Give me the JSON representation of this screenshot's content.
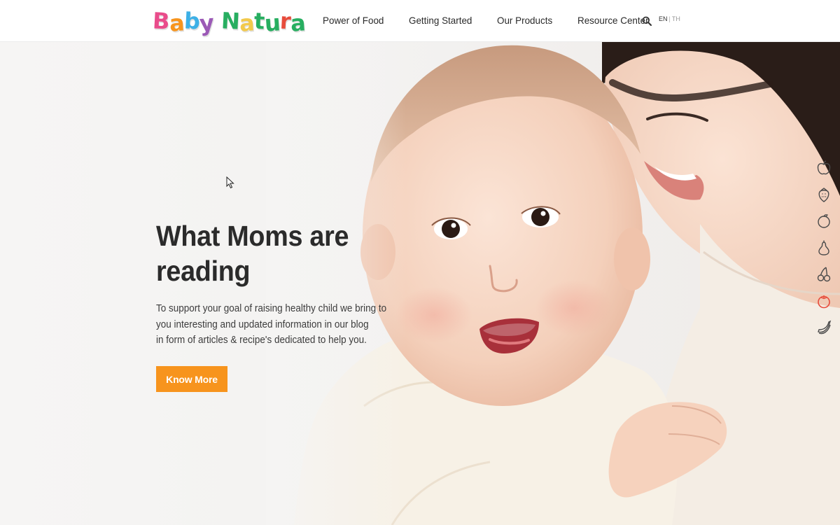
{
  "header": {
    "logo": {
      "word1": "Baby",
      "word2": "Natura",
      "word1_colors": [
        "#e94c8b",
        "#f7941d",
        "#3db0e6",
        "#9b59b6"
      ],
      "word2_colors": [
        "#27ae60",
        "#f2c94c",
        "#27ae60",
        "#27ae60",
        "#e74c3c",
        "#27ae60"
      ]
    },
    "nav": [
      {
        "label": "Power of Food"
      },
      {
        "label": "Getting Started"
      },
      {
        "label": "Our Products"
      },
      {
        "label": "Resource Center"
      }
    ],
    "search_icon": "search-icon",
    "lang": {
      "en": "EN",
      "separator": "|",
      "th": "TH"
    }
  },
  "hero": {
    "headline_line1": "What Moms are",
    "headline_line2": "reading",
    "body_lines": [
      "To support your goal of raising healthy child we bring to",
      "you interesting and updated information in our blog",
      "in form of articles & recipe's dedicated to help you."
    ],
    "cta_label": "Know More",
    "cta_color": "#f7941d"
  },
  "fruit_rail": [
    {
      "icon": "apple-icon",
      "active": false
    },
    {
      "icon": "strawberry-icon",
      "active": false
    },
    {
      "icon": "orange-icon",
      "active": false
    },
    {
      "icon": "pear-icon",
      "active": false
    },
    {
      "icon": "cherry-icon",
      "active": false
    },
    {
      "icon": "tomato-icon",
      "active": true
    },
    {
      "icon": "banana-icon",
      "active": false
    }
  ],
  "colors": {
    "accent": "#f7941d",
    "text_dark": "#2b2b2b",
    "active_icon": "#e74c3c",
    "inactive_icon": "#4a4a4a"
  }
}
